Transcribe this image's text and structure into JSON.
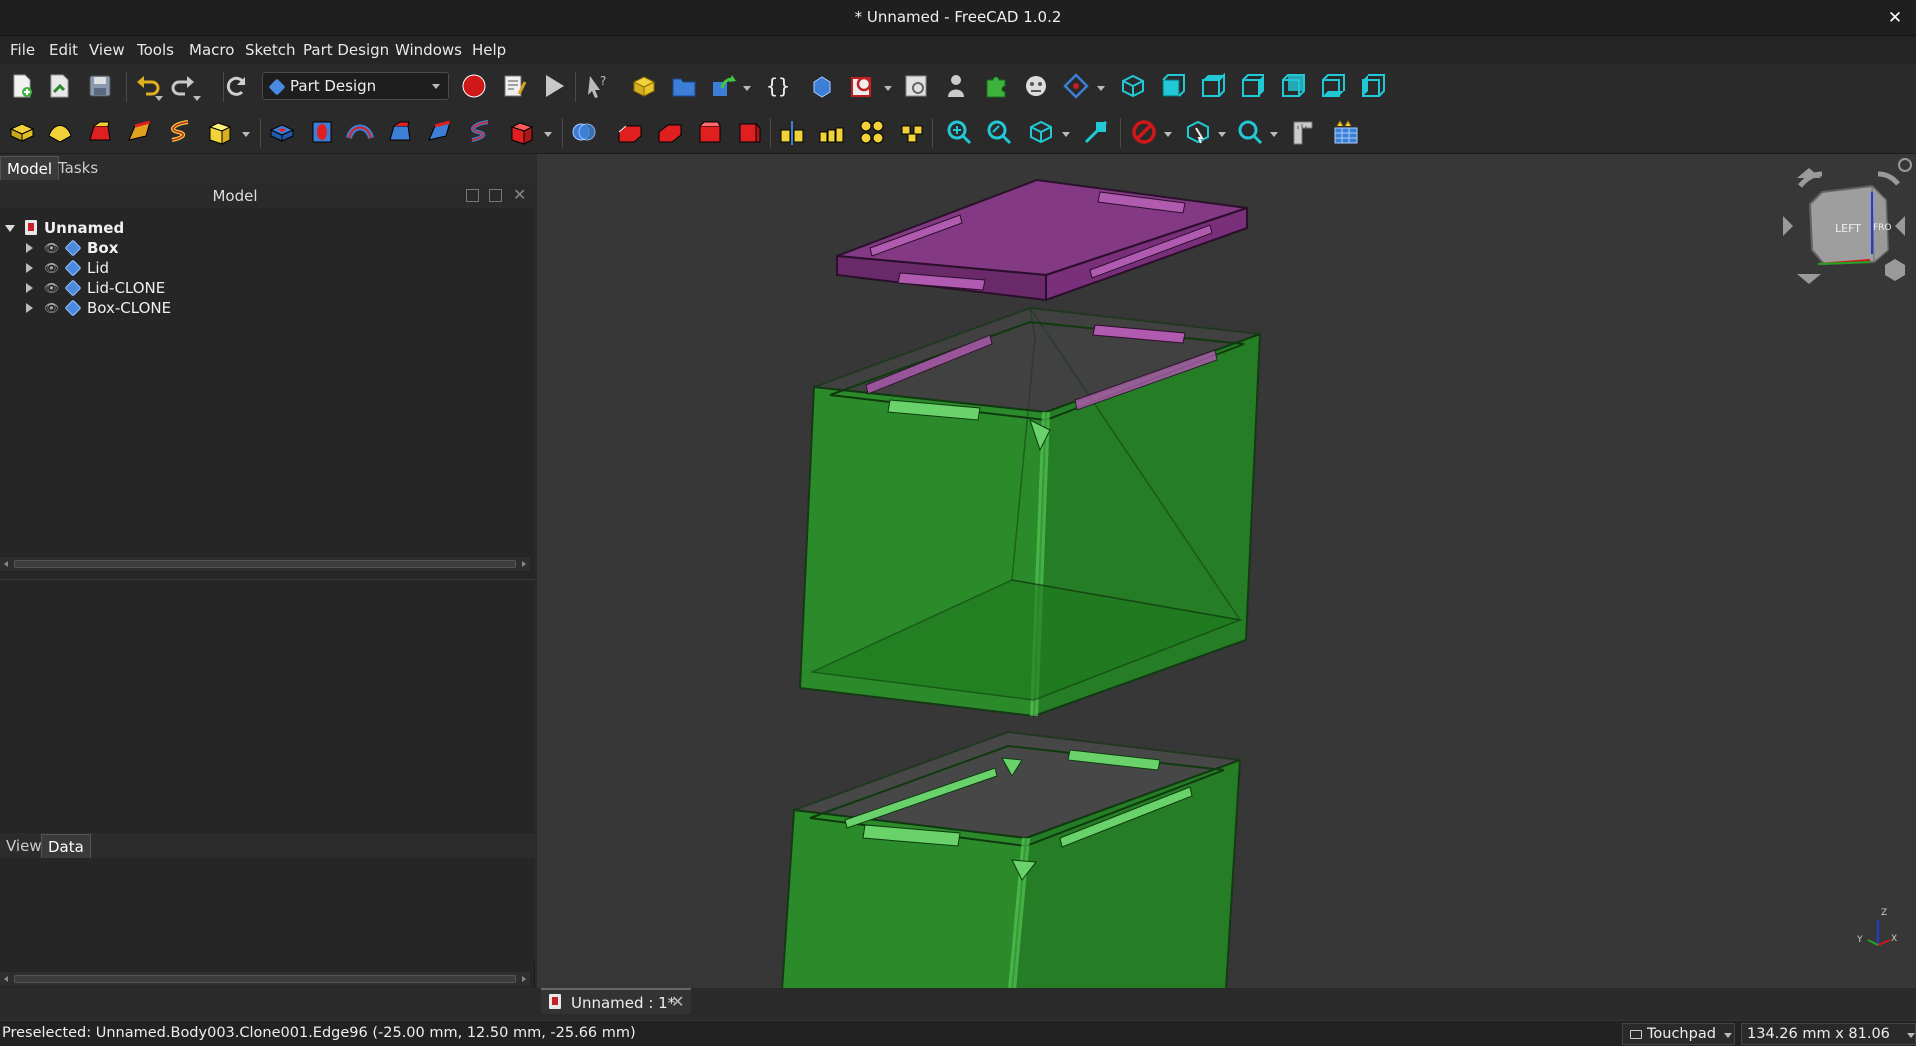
{
  "window": {
    "title": "* Unnamed - FreeCAD 1.0.2"
  },
  "menu": [
    "File",
    "Edit",
    "View",
    "Tools",
    "Macro",
    "Sketch",
    "Part Design",
    "Windows",
    "Help"
  ],
  "toolbar": {
    "workbench": "Part Design"
  },
  "panel": {
    "tabs": [
      "Model",
      "Tasks"
    ],
    "active_tab": "Model",
    "header_title": "Model"
  },
  "tree": {
    "root": "Unnamed",
    "items": [
      "Box",
      "Lid",
      "Lid-CLONE",
      "Box-CLONE"
    ]
  },
  "property_tabs": [
    "View",
    "Data"
  ],
  "document_tab": {
    "label": "Unnamed : 1*"
  },
  "status": {
    "preselection": "Preselected: Unnamed.Body003.Clone001.Edge96 (-25.00 mm, 12.50 mm, -25.66 mm)",
    "navigation_style": "Touchpad",
    "dimension": "134.26 mm x 81.06 mm"
  },
  "nav_cube": {
    "face_left": "LEFT",
    "face_front": "FRO"
  },
  "axis": {
    "z": "Z",
    "y": "Y",
    "x": "X"
  },
  "colors": {
    "box_green": "#2e9e2e",
    "lid_purple": "#8a3a8a",
    "viewport_bg": "#373737",
    "record_red": "#d01818",
    "view_cyan": "#21c9d6"
  }
}
